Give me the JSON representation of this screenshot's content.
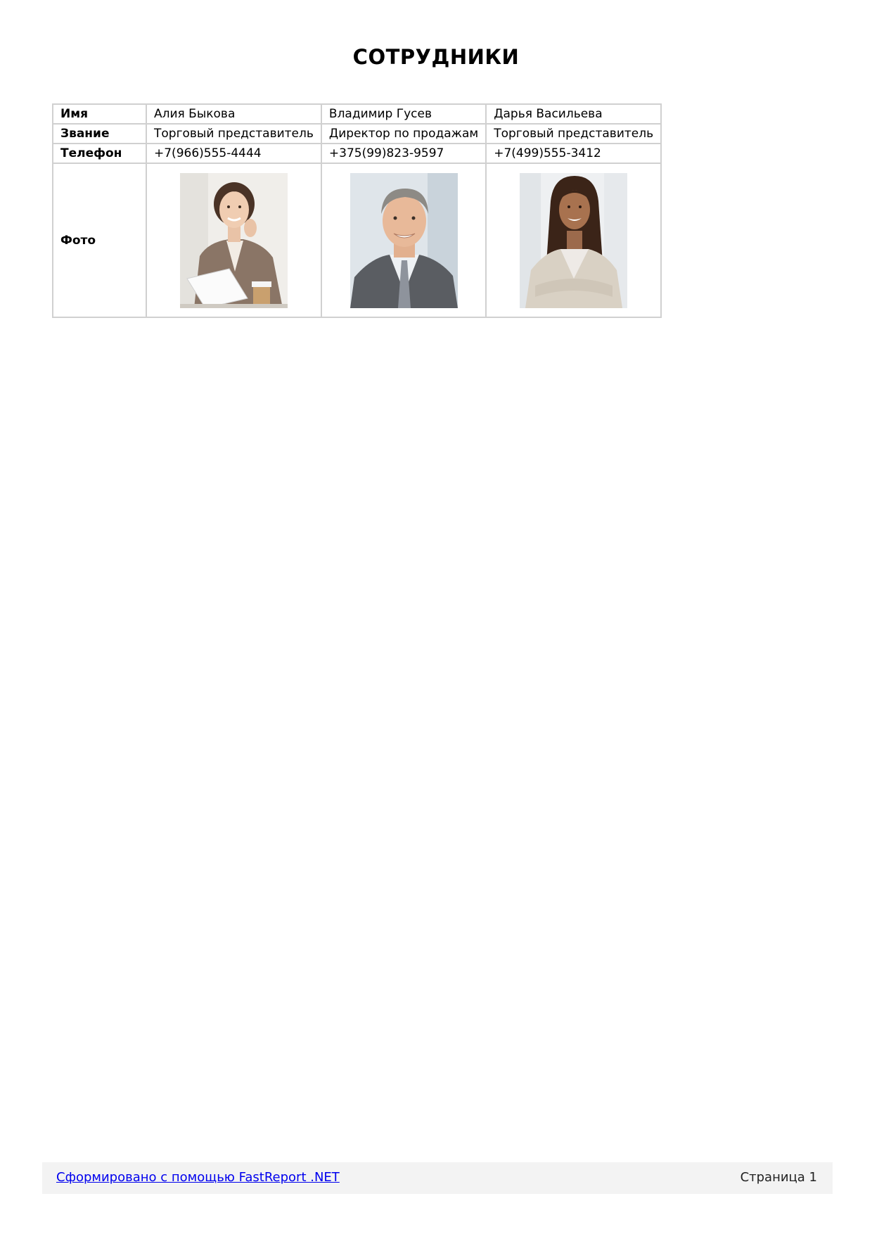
{
  "report": {
    "title": "СОТРУДНИКИ"
  },
  "table": {
    "labels": {
      "name": "Имя",
      "title": "Звание",
      "phone": "Телефон",
      "photo": "Фото"
    },
    "employees": [
      {
        "name": "Алия Быкова",
        "title": "Торговый представитель",
        "phone": "+7(966)555-4444"
      },
      {
        "name": "Владимир Гусев",
        "title": "Директор по продажам",
        "phone": "+375(99)823-9597"
      },
      {
        "name": "Дарья Васильева",
        "title": "Торговый представитель",
        "phone": "+7(499)555-3412"
      }
    ]
  },
  "footer": {
    "link_text": "Сформировано с помощью FastReport .NET",
    "page_text": "Страница 1"
  }
}
